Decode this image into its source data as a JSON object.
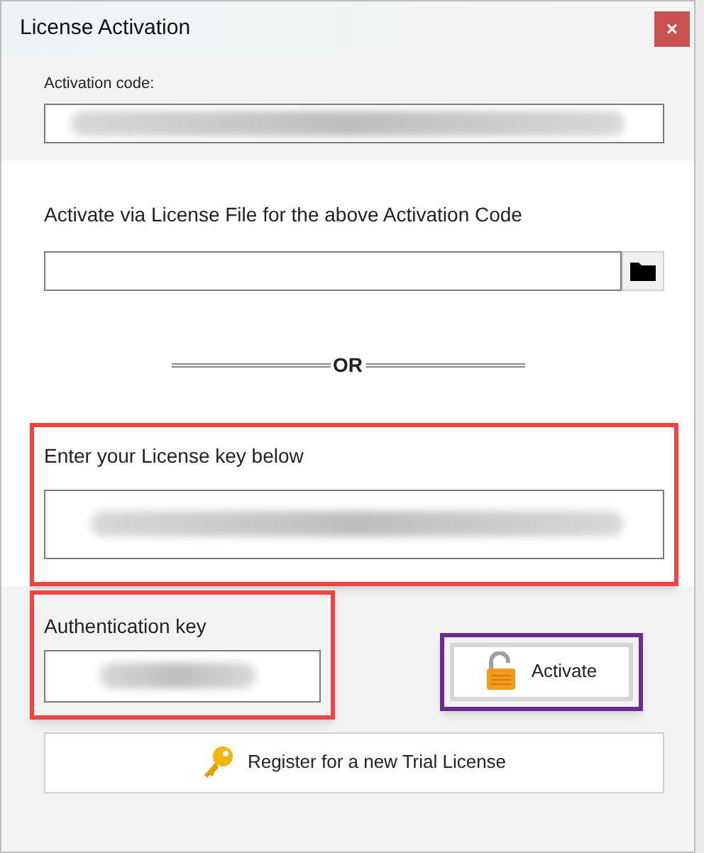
{
  "window": {
    "title": "License Activation",
    "close": "×"
  },
  "activation_code": {
    "label": "Activation code:",
    "redacted": true
  },
  "license_file": {
    "label": "Activate via License File for the above Activation Code"
  },
  "separator": "OR",
  "license_key": {
    "label": "Enter your License key below",
    "redacted": true,
    "highlighted": true,
    "color": "#ef4444"
  },
  "authentication_key": {
    "label": "Authentication key",
    "redacted": true,
    "highlighted": true,
    "color": "#ef4444"
  },
  "activate_button": {
    "label": "Activate",
    "highlighted": true,
    "color": "#6b2c91"
  },
  "register_button": {
    "label": "Register for a new Trial License"
  }
}
